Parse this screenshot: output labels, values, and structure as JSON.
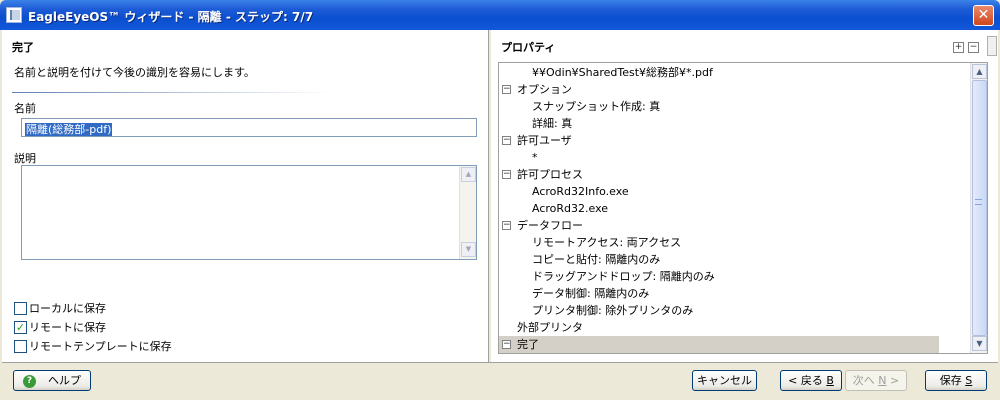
{
  "window": {
    "title": "EagleEyeOS™ ウィザード - 隔離 - ステップ: 7/7",
    "close_glyph": "✕"
  },
  "left": {
    "step_title": "完了",
    "step_desc": "名前と説明を付けて今後の識別を容易にします。",
    "name_label": "名前",
    "name_value": "隔離(総務部-pdf)",
    "desc_label": "説明",
    "desc_value": "",
    "checkboxes": [
      {
        "label": "ローカルに保存",
        "checked": false
      },
      {
        "label": "リモートに保存",
        "checked": true
      },
      {
        "label": "リモートテンプレートに保存",
        "checked": false
      }
    ]
  },
  "properties": {
    "title": "プロパティ",
    "expand_all": "+",
    "collapse_all": "−",
    "rows": [
      {
        "text": "¥¥Odin¥SharedTest¥総務部¥*.pdf",
        "toggle": "",
        "level": 2,
        "selected": false
      },
      {
        "text": "オプション",
        "toggle": "−",
        "level": 1,
        "selected": false
      },
      {
        "text": "スナップショット作成: 真",
        "toggle": "",
        "level": 2,
        "selected": false
      },
      {
        "text": "詳細: 真",
        "toggle": "",
        "level": 2,
        "selected": false
      },
      {
        "text": "許可ユーザ",
        "toggle": "−",
        "level": 1,
        "selected": false
      },
      {
        "text": "*",
        "toggle": "",
        "level": 2,
        "selected": false
      },
      {
        "text": "許可プロセス",
        "toggle": "−",
        "level": 1,
        "selected": false
      },
      {
        "text": "AcroRd32Info.exe",
        "toggle": "",
        "level": 2,
        "selected": false
      },
      {
        "text": "AcroRd32.exe",
        "toggle": "",
        "level": 2,
        "selected": false
      },
      {
        "text": "データフロー",
        "toggle": "−",
        "level": 1,
        "selected": false
      },
      {
        "text": "リモートアクセス: 両アクセス",
        "toggle": "",
        "level": 2,
        "selected": false
      },
      {
        "text": "コピーと貼付: 隔離内のみ",
        "toggle": "",
        "level": 2,
        "selected": false
      },
      {
        "text": "ドラッグアンドドロップ: 隔離内のみ",
        "toggle": "",
        "level": 2,
        "selected": false
      },
      {
        "text": "データ制御: 隔離内のみ",
        "toggle": "",
        "level": 2,
        "selected": false
      },
      {
        "text": "プリンタ制御: 除外プリンタのみ",
        "toggle": "",
        "level": 2,
        "selected": false
      },
      {
        "text": "外部プリンタ",
        "toggle": "",
        "level": 1,
        "selected": false
      },
      {
        "text": "完了",
        "toggle": "−",
        "level": 1,
        "selected": true
      }
    ]
  },
  "footer": {
    "help_icon_glyph": "?",
    "help_label": "ヘルプ",
    "cancel_label": "キャンセル",
    "back_label": "< 戻る",
    "back_key": "B",
    "next_label": "次へ",
    "next_key": "N",
    "next_suffix": " >",
    "save_label": "保存",
    "save_key": "S"
  }
}
